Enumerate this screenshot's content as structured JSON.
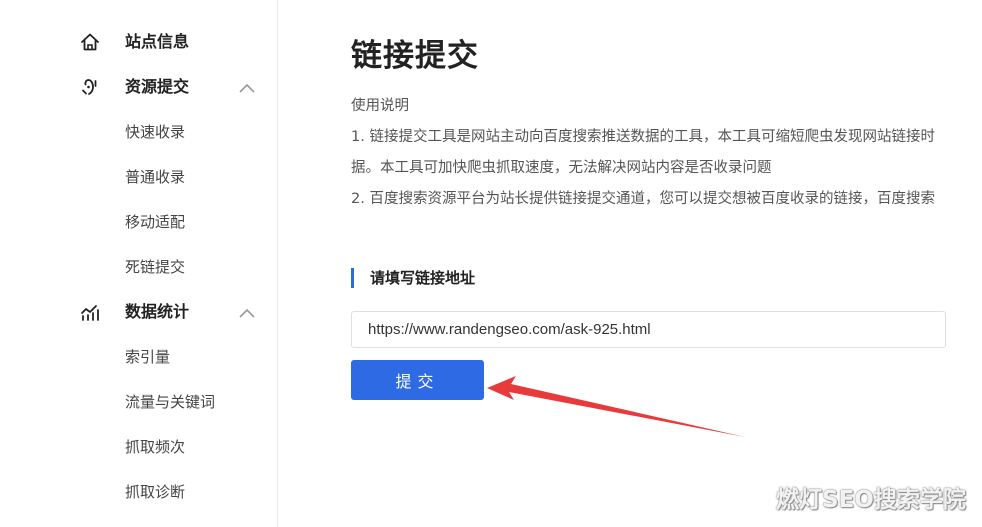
{
  "sidebar": {
    "site_info": {
      "label": "站点信息",
      "icon": "home-icon"
    },
    "resource_submit": {
      "label": "资源提交",
      "icon": "link-hand-icon",
      "expanded": true,
      "items": [
        "快速收录",
        "普通收录",
        "移动适配",
        "死链提交"
      ]
    },
    "data_stats": {
      "label": "数据统计",
      "icon": "chart-icon",
      "expanded": true,
      "items": [
        "索引量",
        "流量与关键词",
        "抓取频次",
        "抓取诊断"
      ]
    }
  },
  "main": {
    "title": "链接提交",
    "usage_title": "使用说明",
    "usage_line1": "1. 链接提交工具是网站主动向百度搜索推送数据的工具，本工具可缩短爬虫发现网站链接时",
    "usage_line1b": "据。本工具可加快爬虫抓取速度，无法解决网站内容是否收录问题",
    "usage_line2": "2. 百度搜索资源平台为站长提供链接提交通道，您可以提交想被百度收录的链接，百度搜索",
    "section_title": "请填写链接地址",
    "url_value": "https://www.randengseo.com/ask-925.html",
    "submit_label": "提交"
  },
  "colors": {
    "accent": "#2f6ae5",
    "arrow": "#e8393b"
  },
  "watermark": "燃灯SEO搜索学院"
}
